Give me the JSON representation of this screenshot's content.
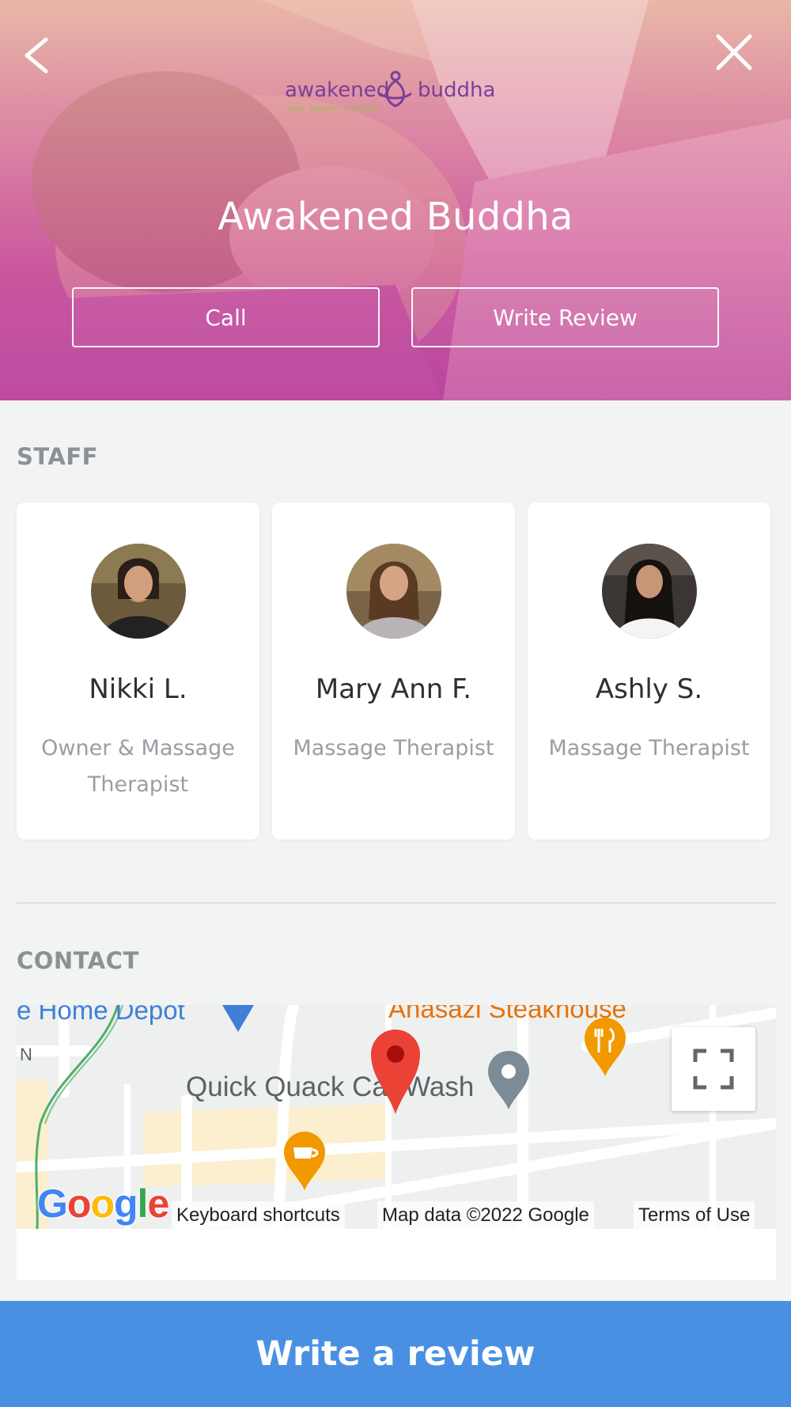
{
  "header": {
    "logo_text": "awakened buddha",
    "logo_tagline": "exist · become · transform",
    "title": "Awakened Buddha",
    "call_label": "Call",
    "write_review_label": "Write Review"
  },
  "staff": {
    "heading": "STAFF",
    "members": [
      {
        "name": "Nikki L.",
        "role": "Owner & Massage Therapist"
      },
      {
        "name": "Mary Ann F.",
        "role": "Massage Therapist"
      },
      {
        "name": "Ashly S.",
        "role": "Massage Therapist"
      }
    ]
  },
  "contact": {
    "heading": "CONTACT",
    "map": {
      "labels": {
        "home_depot": "e Home Depot",
        "steakhouse": "Anasazi Steakhouse",
        "quick_quack": "Quick Quack Car Wash",
        "street_n": "N"
      },
      "google_logo": "Google",
      "keyboard_shortcuts": "Keyboard shortcuts",
      "map_data": "Map data ©2022 Google",
      "terms": "Terms of Use"
    }
  },
  "footer": {
    "cta_label": "Write a review"
  },
  "colors": {
    "accent": "#4a90e2",
    "hero_pink": "#c4569a",
    "logo_purple": "#7b3f98",
    "logo_green": "#8cc63f"
  },
  "icons": [
    "chevron-left-icon",
    "close-icon",
    "fullscreen-icon",
    "map-pin-icon",
    "restaurant-icon",
    "coffee-icon",
    "gray-pin-icon",
    "blue-arrow-icon"
  ]
}
